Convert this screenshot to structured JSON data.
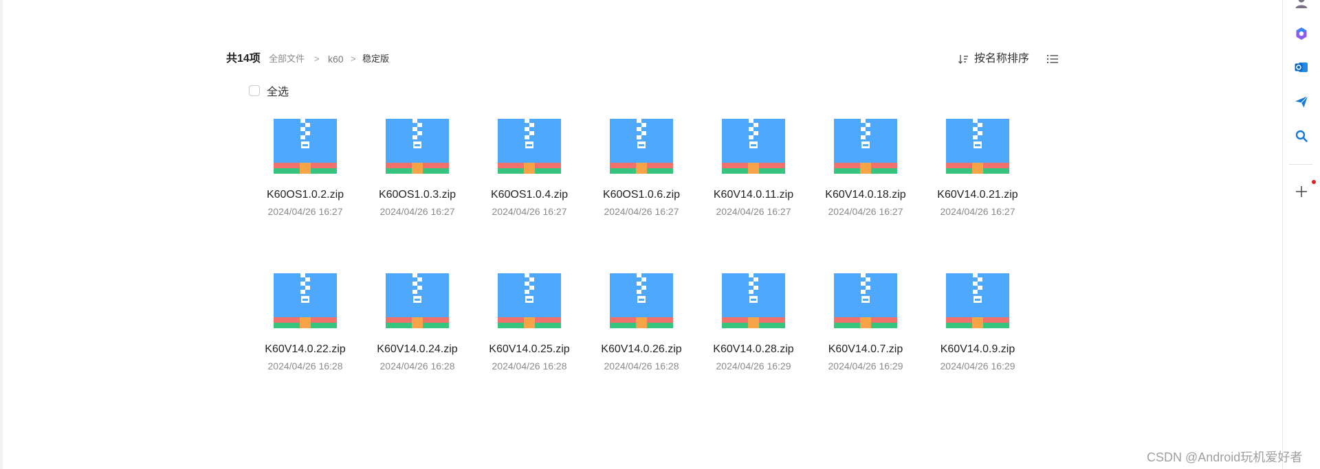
{
  "breadcrumb": {
    "count_label": "共14项",
    "all_files": "全部文件",
    "separator": ">",
    "folder": "k60",
    "current": "稳定版"
  },
  "toolbar": {
    "sort_label": "按名称排序",
    "sort_icon": "sort-ascending-icon",
    "view_icon": "list-view-icon"
  },
  "select_all": {
    "label": "全选",
    "checked": false
  },
  "files": [
    {
      "name": "K60OS1.0.2.zip",
      "date": "2024/04/26 16:27",
      "icon": "zip-file-icon"
    },
    {
      "name": "K60OS1.0.3.zip",
      "date": "2024/04/26 16:27",
      "icon": "zip-file-icon"
    },
    {
      "name": "K60OS1.0.4.zip",
      "date": "2024/04/26 16:27",
      "icon": "zip-file-icon"
    },
    {
      "name": "K60OS1.0.6.zip",
      "date": "2024/04/26 16:27",
      "icon": "zip-file-icon"
    },
    {
      "name": "K60V14.0.11.zip",
      "date": "2024/04/26 16:27",
      "icon": "zip-file-icon"
    },
    {
      "name": "K60V14.0.18.zip",
      "date": "2024/04/26 16:27",
      "icon": "zip-file-icon"
    },
    {
      "name": "K60V14.0.21.zip",
      "date": "2024/04/26 16:27",
      "icon": "zip-file-icon"
    },
    {
      "name": "K60V14.0.22.zip",
      "date": "2024/04/26 16:28",
      "icon": "zip-file-icon"
    },
    {
      "name": "K60V14.0.24.zip",
      "date": "2024/04/26 16:28",
      "icon": "zip-file-icon"
    },
    {
      "name": "K60V14.0.25.zip",
      "date": "2024/04/26 16:28",
      "icon": "zip-file-icon"
    },
    {
      "name": "K60V14.0.26.zip",
      "date": "2024/04/26 16:28",
      "icon": "zip-file-icon"
    },
    {
      "name": "K60V14.0.28.zip",
      "date": "2024/04/26 16:29",
      "icon": "zip-file-icon"
    },
    {
      "name": "K60V14.0.7.zip",
      "date": "2024/04/26 16:29",
      "icon": "zip-file-icon"
    },
    {
      "name": "K60V14.0.9.zip",
      "date": "2024/04/26 16:29",
      "icon": "zip-file-icon"
    }
  ],
  "sidebar": {
    "items": [
      {
        "icon": "user-icon"
      },
      {
        "icon": "copilot-icon"
      },
      {
        "icon": "outlook-icon"
      },
      {
        "icon": "send-icon"
      },
      {
        "icon": "search-icon"
      },
      {
        "icon": "add-icon"
      }
    ]
  },
  "watermark": "CSDN @Android玩机爱好者",
  "colors": {
    "zip_blue": "#4da7fb",
    "zip_red": "#f2716b",
    "zip_green": "#36c47f",
    "zip_orange": "#f7a449",
    "accent": "#1a73e8",
    "notification_dot": "#e02020"
  }
}
